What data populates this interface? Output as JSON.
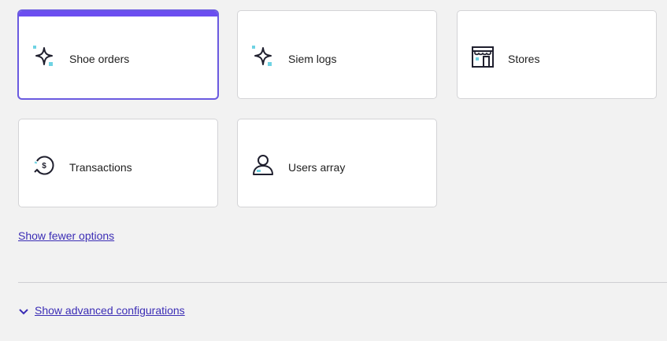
{
  "cards": [
    {
      "label": "Shoe orders",
      "icon": "sparkle-icon",
      "selected": true
    },
    {
      "label": "Siem logs",
      "icon": "sparkle-icon",
      "selected": false
    },
    {
      "label": "Stores",
      "icon": "store-icon",
      "selected": false
    },
    {
      "label": "Transactions",
      "icon": "currency-refresh-icon",
      "selected": false
    },
    {
      "label": "Users array",
      "icon": "users-icon",
      "selected": false
    }
  ],
  "links": {
    "show_fewer": "Show fewer options",
    "show_advanced": "Show advanced configurations"
  },
  "colors": {
    "accent": "#6b4ef0",
    "link": "#3b2db5",
    "icon_secondary": "#6fd3e3",
    "background": "#f2f2f2"
  }
}
